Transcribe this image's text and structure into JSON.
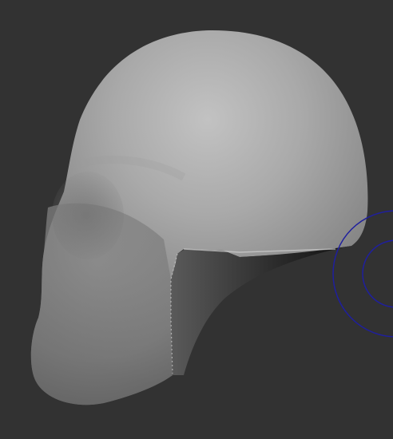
{
  "viewport": {
    "background_color": "#323232",
    "model": {
      "kind": "3d-head-mesh",
      "surface_color": "#bdbdbd",
      "shadow_color": "#000000"
    },
    "gizmo": {
      "kind": "transform-gizmo-rings",
      "ring_color": "#1f1f9e"
    }
  }
}
